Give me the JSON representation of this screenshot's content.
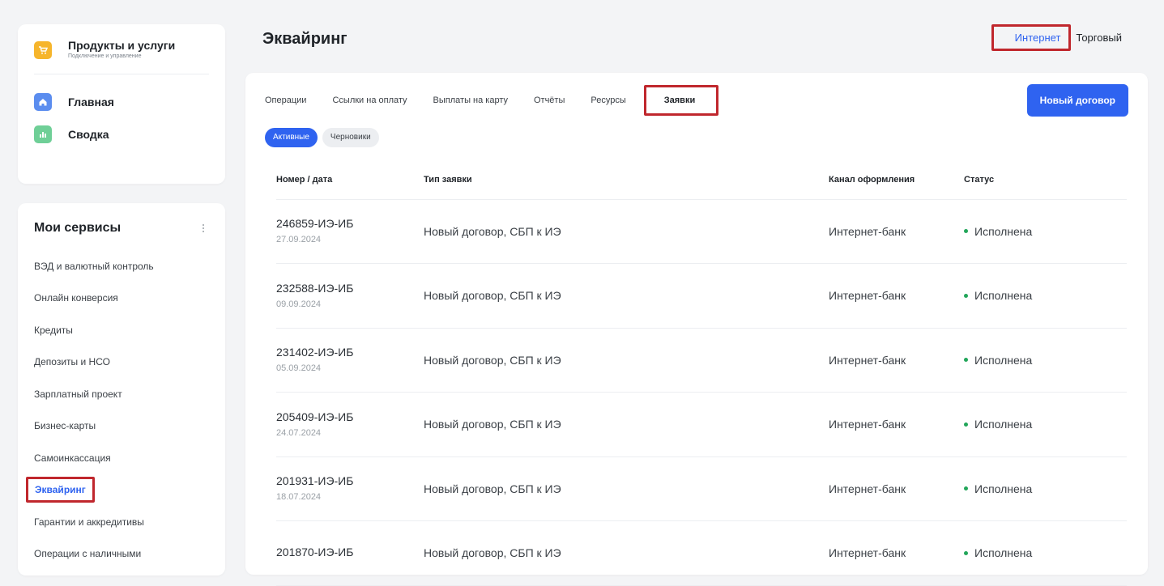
{
  "sidebar": {
    "products": {
      "title": "Продукты и услуги",
      "subtitle": "Подключение и управление",
      "icon": "cart-icon",
      "icon_color": "#f6b52c"
    },
    "nav": [
      {
        "label": "Главная",
        "icon": "home-icon",
        "icon_color": "#5b8def"
      },
      {
        "label": "Сводка",
        "icon": "chart-icon",
        "icon_color": "#6fcf97"
      }
    ],
    "services": {
      "title": "Мои сервисы",
      "items": [
        {
          "label": "ВЭД и валютный контроль"
        },
        {
          "label": "Онлайн конверсия"
        },
        {
          "label": "Кредиты"
        },
        {
          "label": "Депозиты и НСО"
        },
        {
          "label": "Зарплатный проект"
        },
        {
          "label": "Бизнес-карты"
        },
        {
          "label": "Самоинкассация"
        },
        {
          "label": "Эквайринг",
          "active": true
        },
        {
          "label": "Гарантии и аккредитивы"
        },
        {
          "label": "Операции с наличными"
        }
      ]
    }
  },
  "header": {
    "title": "Эквайринг",
    "channels": [
      {
        "label": "Интернет",
        "active": true
      },
      {
        "label": "Торговый",
        "active": false
      }
    ]
  },
  "main": {
    "tabs": [
      {
        "label": "Операции"
      },
      {
        "label": "Ссылки на оплату"
      },
      {
        "label": "Выплаты на карту"
      },
      {
        "label": "Отчёты"
      },
      {
        "label": "Ресурсы"
      },
      {
        "label": "Заявки",
        "active": true
      }
    ],
    "new_contract_label": "Новый договор",
    "filters": [
      {
        "label": "Активные",
        "active": true
      },
      {
        "label": "Черновики",
        "active": false
      }
    ],
    "table": {
      "columns": [
        "Номер / дата",
        "Тип заявки",
        "Канал оформления",
        "Статус"
      ],
      "rows": [
        {
          "number": "246859-ИЭ-ИБ",
          "date": "27.09.2024",
          "type": "Новый договор, СБП к ИЭ",
          "channel": "Интернет-банк",
          "status": "Исполнена"
        },
        {
          "number": "232588-ИЭ-ИБ",
          "date": "09.09.2024",
          "type": "Новый договор, СБП к ИЭ",
          "channel": "Интернет-банк",
          "status": "Исполнена"
        },
        {
          "number": "231402-ИЭ-ИБ",
          "date": "05.09.2024",
          "type": "Новый договор, СБП к ИЭ",
          "channel": "Интернет-банк",
          "status": "Исполнена"
        },
        {
          "number": "205409-ИЭ-ИБ",
          "date": "24.07.2024",
          "type": "Новый договор, СБП к ИЭ",
          "channel": "Интернет-банк",
          "status": "Исполнена"
        },
        {
          "number": "201931-ИЭ-ИБ",
          "date": "18.07.2024",
          "type": "Новый договор, СБП к ИЭ",
          "channel": "Интернет-банк",
          "status": "Исполнена"
        },
        {
          "number": "201870-ИЭ-ИБ",
          "date": "",
          "type": "Новый договор, СБП к ИЭ",
          "channel": "Интернет-банк",
          "status": "Исполнена"
        }
      ]
    },
    "status_color": "#22a65a",
    "accent_color": "#2f63f0",
    "highlight_color": "#c0272d"
  }
}
